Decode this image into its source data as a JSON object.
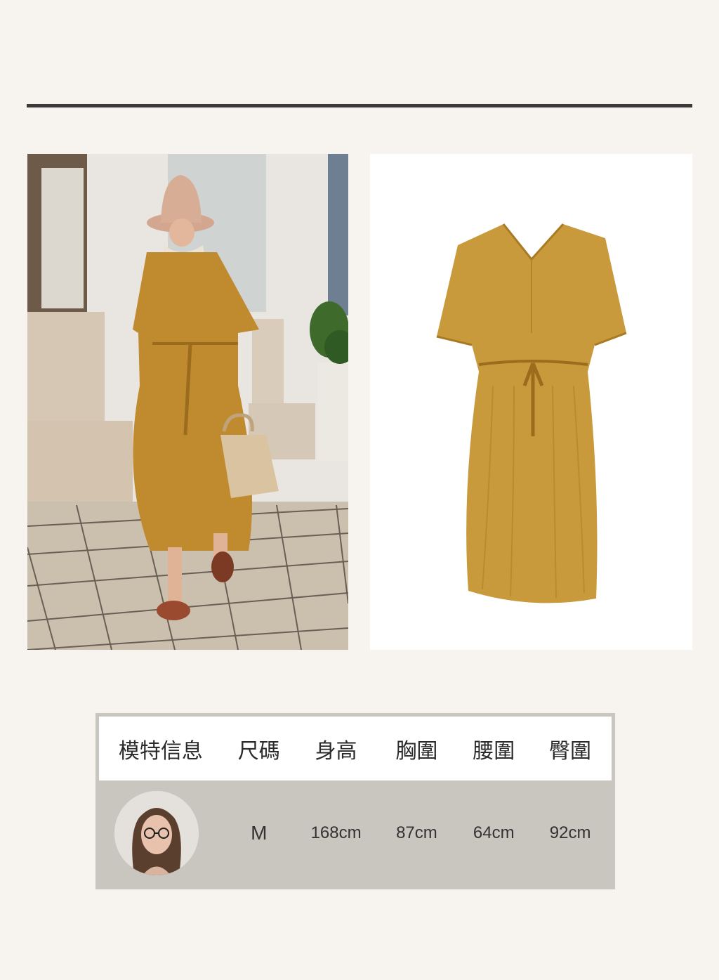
{
  "colors": {
    "background": "#f7f3ee",
    "rule": "#3a3a3a",
    "dress": "#c99a3c",
    "table_head": "#ffffff",
    "table_body": "#c9c5bf"
  },
  "photos": {
    "model_photo_icon": "model-wearing-dress-photo",
    "product_photo_icon": "flat-dress-product-photo"
  },
  "model_table": {
    "headers": [
      "模特信息",
      "尺碼",
      "身高",
      "胸圍",
      "腰圍",
      "臀圍"
    ],
    "row": {
      "avatar_icon": "model-portrait-avatar",
      "size": "M",
      "height": "168cm",
      "bust": "87cm",
      "waist": "64cm",
      "hips": "92cm"
    }
  }
}
